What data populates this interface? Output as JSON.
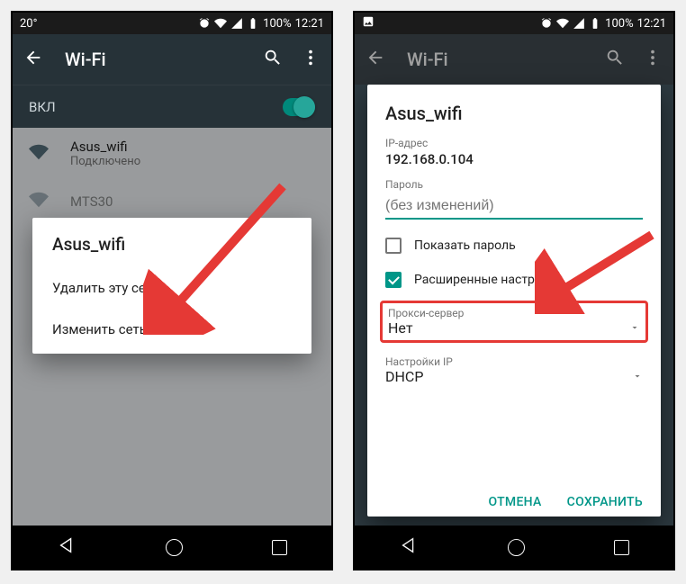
{
  "status": {
    "temp": "20°",
    "battery_pct": "100%",
    "time": "12:21"
  },
  "wifi": {
    "appbar_title": "Wi-Fi",
    "toggle_label": "ВКЛ",
    "networks": [
      {
        "name": "Asus_wifi",
        "sub": "Подключено"
      },
      {
        "name": "MTS30",
        "sub": ""
      }
    ]
  },
  "context_menu": {
    "title": "Asus_wifi",
    "delete": "Удалить эту сеть",
    "modify": "Изменить сеть"
  },
  "dialog": {
    "title": "Asus_wifi",
    "ip_label": "IP-адрес",
    "ip_value": "192.168.0.104",
    "password_label": "Пароль",
    "password_placeholder": "(без изменений)",
    "show_password": "Показать пароль",
    "advanced": "Расширенные настройки",
    "proxy_label": "Прокси-сервер",
    "proxy_value": "Нет",
    "ip_settings_label": "Настройки IP",
    "ip_settings_value": "DHCP",
    "cancel": "ОТМЕНА",
    "save": "СОХРАНИТЬ"
  }
}
